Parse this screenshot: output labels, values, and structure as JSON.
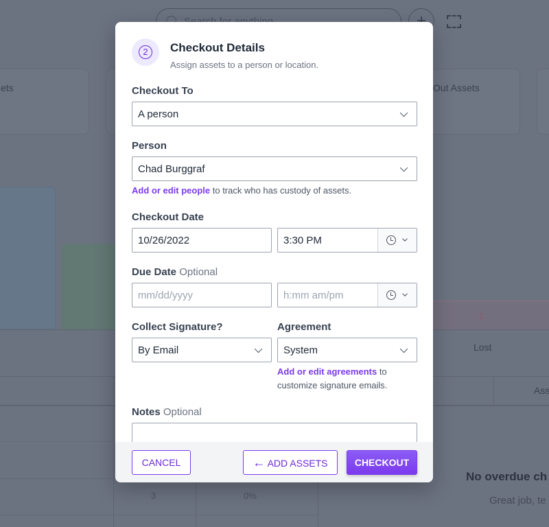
{
  "background": {
    "search_placeholder": "Search for anything",
    "plus_label": "+",
    "card_left": "ets",
    "card_right": "Out Assets",
    "chart_value": "1",
    "lost_label": "Lost",
    "col_header": "Ass",
    "row_count": "3",
    "row_pct": "0%",
    "empty_title": "No overdue ch",
    "empty_sub": "Great job, te"
  },
  "modal": {
    "step": "2",
    "title": "Checkout Details",
    "subtitle": "Assign assets to a person or location.",
    "checkout_to": {
      "label": "Checkout To",
      "value": "A person"
    },
    "person": {
      "label": "Person",
      "value": "Chad Burggraf",
      "help_link": "Add or edit people",
      "help_text": " to track who has custody of assets."
    },
    "checkout_date": {
      "label": "Checkout Date",
      "date": "10/26/2022",
      "time": "3:30 PM"
    },
    "due_date": {
      "label": "Due Date",
      "optional": "Optional",
      "date_placeholder": "mm/dd/yyyy",
      "time_placeholder": "h:mm am/pm"
    },
    "signature": {
      "label": "Collect Signature?",
      "value": "By Email"
    },
    "agreement": {
      "label": "Agreement",
      "value": "System",
      "help_link": "Add or edit agreements",
      "help_text": " to customize signature emails."
    },
    "notes": {
      "label": "Notes",
      "optional": "Optional",
      "value": ""
    },
    "buttons": {
      "cancel": "CANCEL",
      "add_assets": "ADD ASSETS",
      "checkout": "CHECKOUT"
    },
    "accent": "#7c3aed"
  }
}
